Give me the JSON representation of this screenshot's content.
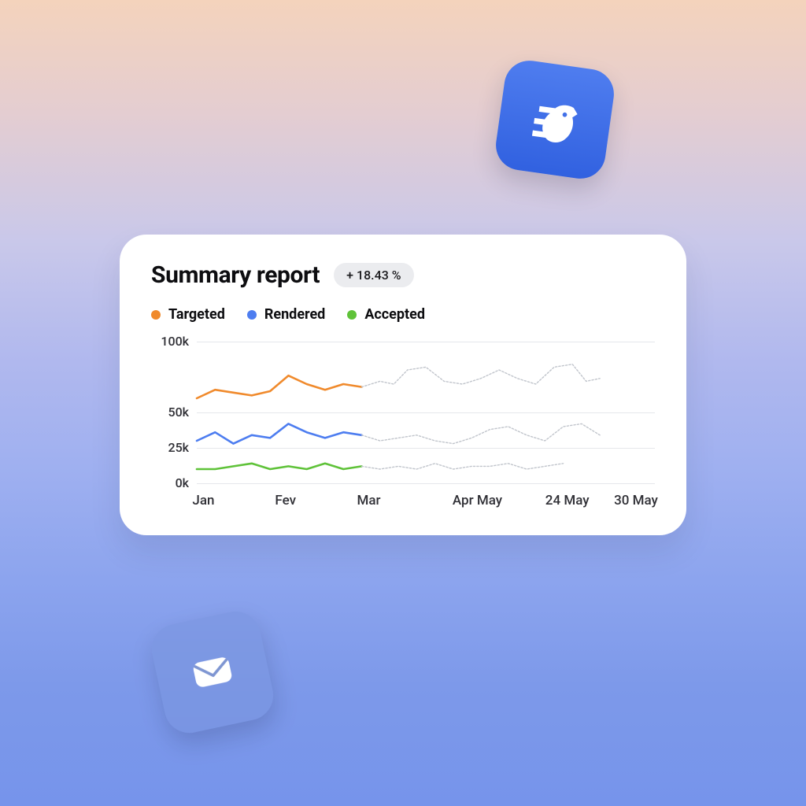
{
  "card": {
    "title": "Summary report",
    "badge": "+ 18.43 %"
  },
  "legend": [
    {
      "label": "Targeted",
      "color": "#f08a2c"
    },
    {
      "label": "Rendered",
      "color": "#4d7df0"
    },
    {
      "label": "Accepted",
      "color": "#5fc239"
    }
  ],
  "chart_data": {
    "type": "line",
    "xlabel": "",
    "ylabel": "",
    "ylim": [
      0,
      100
    ],
    "y_ticks": [
      {
        "label": "100k",
        "value": 100
      },
      {
        "label": "50k",
        "value": 50
      },
      {
        "label": "25k",
        "value": 25
      },
      {
        "label": "0k",
        "value": 0
      }
    ],
    "x_ticks": [
      {
        "label": "Jan",
        "x": 0
      },
      {
        "label": "Fev",
        "x": 18
      },
      {
        "label": "Mar",
        "x": 36
      },
      {
        "label": "Apr May",
        "x": 58
      },
      {
        "label": "24 May",
        "x": 78
      },
      {
        "label": "30 May",
        "x": 93
      }
    ],
    "series": [
      {
        "name": "Targeted",
        "color": "#f08a2c",
        "solid": [
          {
            "x": 0,
            "y": 60
          },
          {
            "x": 4,
            "y": 66
          },
          {
            "x": 8,
            "y": 64
          },
          {
            "x": 12,
            "y": 62
          },
          {
            "x": 16,
            "y": 65
          },
          {
            "x": 20,
            "y": 76
          },
          {
            "x": 24,
            "y": 70
          },
          {
            "x": 28,
            "y": 66
          },
          {
            "x": 32,
            "y": 70
          },
          {
            "x": 36,
            "y": 68
          }
        ],
        "projected": [
          {
            "x": 36,
            "y": 68
          },
          {
            "x": 40,
            "y": 72
          },
          {
            "x": 43,
            "y": 70
          },
          {
            "x": 46,
            "y": 80
          },
          {
            "x": 50,
            "y": 82
          },
          {
            "x": 54,
            "y": 72
          },
          {
            "x": 58,
            "y": 70
          },
          {
            "x": 62,
            "y": 74
          },
          {
            "x": 66,
            "y": 80
          },
          {
            "x": 70,
            "y": 74
          },
          {
            "x": 74,
            "y": 70
          },
          {
            "x": 78,
            "y": 82
          },
          {
            "x": 82,
            "y": 84
          },
          {
            "x": 85,
            "y": 72
          },
          {
            "x": 88,
            "y": 74
          }
        ]
      },
      {
        "name": "Rendered",
        "color": "#4d7df0",
        "solid": [
          {
            "x": 0,
            "y": 30
          },
          {
            "x": 4,
            "y": 36
          },
          {
            "x": 8,
            "y": 28
          },
          {
            "x": 12,
            "y": 34
          },
          {
            "x": 16,
            "y": 32
          },
          {
            "x": 20,
            "y": 42
          },
          {
            "x": 24,
            "y": 36
          },
          {
            "x": 28,
            "y": 32
          },
          {
            "x": 32,
            "y": 36
          },
          {
            "x": 36,
            "y": 34
          }
        ],
        "projected": [
          {
            "x": 36,
            "y": 34
          },
          {
            "x": 40,
            "y": 30
          },
          {
            "x": 44,
            "y": 32
          },
          {
            "x": 48,
            "y": 34
          },
          {
            "x": 52,
            "y": 30
          },
          {
            "x": 56,
            "y": 28
          },
          {
            "x": 60,
            "y": 32
          },
          {
            "x": 64,
            "y": 38
          },
          {
            "x": 68,
            "y": 40
          },
          {
            "x": 72,
            "y": 34
          },
          {
            "x": 76,
            "y": 30
          },
          {
            "x": 80,
            "y": 40
          },
          {
            "x": 84,
            "y": 42
          },
          {
            "x": 88,
            "y": 34
          }
        ]
      },
      {
        "name": "Accepted",
        "color": "#5fc239",
        "solid": [
          {
            "x": 0,
            "y": 10
          },
          {
            "x": 4,
            "y": 10
          },
          {
            "x": 8,
            "y": 12
          },
          {
            "x": 12,
            "y": 14
          },
          {
            "x": 16,
            "y": 10
          },
          {
            "x": 20,
            "y": 12
          },
          {
            "x": 24,
            "y": 10
          },
          {
            "x": 28,
            "y": 14
          },
          {
            "x": 32,
            "y": 10
          },
          {
            "x": 36,
            "y": 12
          }
        ],
        "projected": [
          {
            "x": 36,
            "y": 12
          },
          {
            "x": 40,
            "y": 10
          },
          {
            "x": 44,
            "y": 12
          },
          {
            "x": 48,
            "y": 10
          },
          {
            "x": 52,
            "y": 14
          },
          {
            "x": 56,
            "y": 10
          },
          {
            "x": 60,
            "y": 12
          },
          {
            "x": 64,
            "y": 12
          },
          {
            "x": 68,
            "y": 14
          },
          {
            "x": 72,
            "y": 10
          },
          {
            "x": 76,
            "y": 12
          },
          {
            "x": 80,
            "y": 14
          }
        ]
      }
    ]
  }
}
